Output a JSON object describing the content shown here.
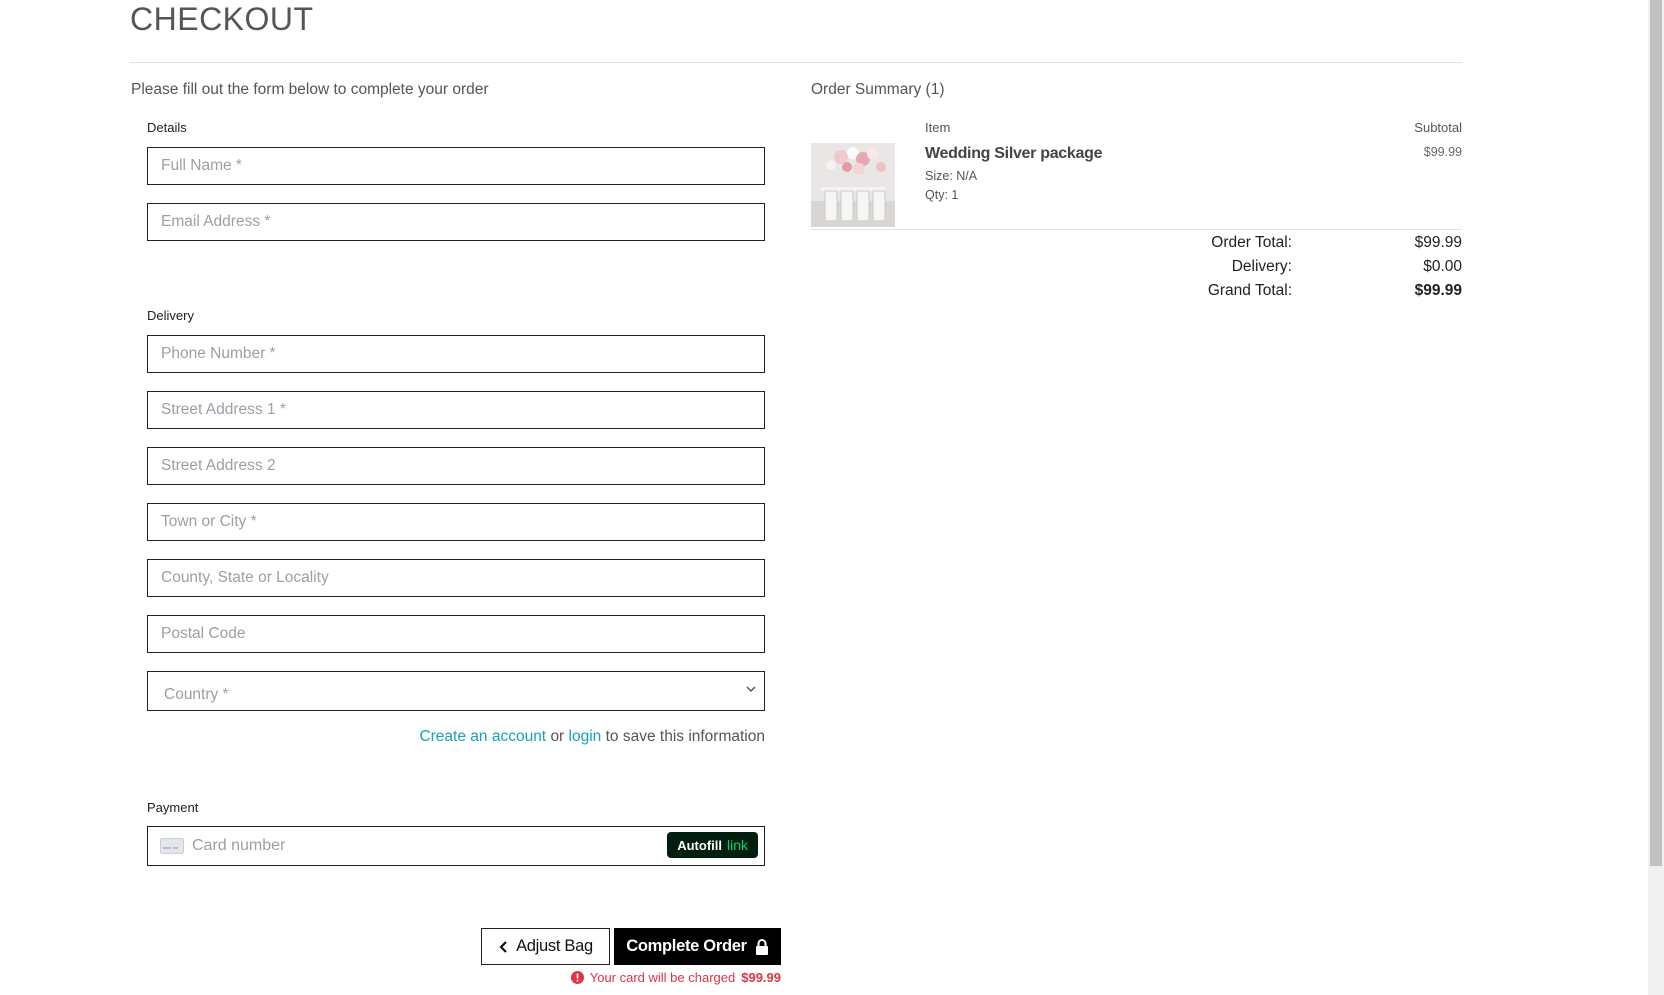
{
  "page": {
    "title": "CHECKOUT",
    "instructions": "Please fill out the form below to complete your order"
  },
  "details": {
    "label": "Details",
    "full_name_placeholder": "Full Name *",
    "email_placeholder": "Email Address *"
  },
  "delivery": {
    "label": "Delivery",
    "phone_placeholder": "Phone Number *",
    "street1_placeholder": "Street Address 1 *",
    "street2_placeholder": "Street Address 2",
    "town_placeholder": "Town or City *",
    "county_placeholder": "County, State or Locality",
    "postcode_placeholder": "Postal Code",
    "country_placeholder": "Country *",
    "create_account_link": "Create an account",
    "or_text": "or",
    "login_link": "login",
    "save_info_text": "to save this information"
  },
  "payment": {
    "label": "Payment",
    "card_placeholder": "Card number",
    "autofill_label": "Autofill",
    "autofill_link_text": "link"
  },
  "actions": {
    "adjust_bag_label": "Adjust Bag",
    "complete_order_label": "Complete Order",
    "charge_note_prefix": "Your card will be charged",
    "charge_amount": "$99.99"
  },
  "summary": {
    "title": "Order Summary (1)",
    "col_item": "Item",
    "col_subtotal": "Subtotal",
    "items": [
      {
        "name": "Wedding Silver package",
        "size": "Size: N/A",
        "qty": "Qty: 1",
        "subtotal": "$99.99"
      }
    ],
    "order_total_label": "Order Total:",
    "order_total_value": "$99.99",
    "delivery_label": "Delivery:",
    "delivery_value": "$0.00",
    "grand_total_label": "Grand Total:",
    "grand_total_value": "$99.99"
  },
  "colors": {
    "link": "#17a2b8",
    "error": "#dc3545",
    "button_primary": "#000000",
    "autofill_bg": "#011e0f",
    "autofill_accent": "#00d66f"
  }
}
